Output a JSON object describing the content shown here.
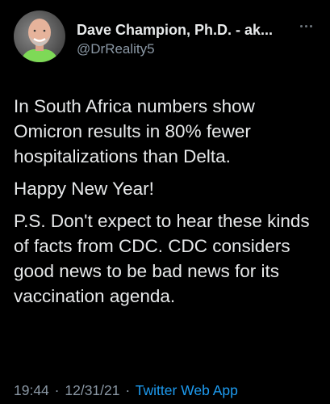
{
  "author": {
    "display_name": "Dave Champion, Ph.D. - ak...",
    "handle": "@DrReality5",
    "avatar_icon": "profile-photo"
  },
  "tweet": {
    "paragraphs": [
      "In South Africa numbers show Omicron results in 80% fewer hospitalizations than Delta.",
      "Happy New Year!",
      "P.S. Don't expect to hear these kinds of facts from CDC. CDC considers good news to be bad news for its vaccination agenda."
    ]
  },
  "meta": {
    "time": "19:44",
    "separator": "·",
    "date": "12/31/21",
    "source": "Twitter Web App"
  },
  "colors": {
    "background": "#000000",
    "text": "#e7e9ea",
    "muted": "#8b98a5",
    "link": "#1d9bf0"
  }
}
